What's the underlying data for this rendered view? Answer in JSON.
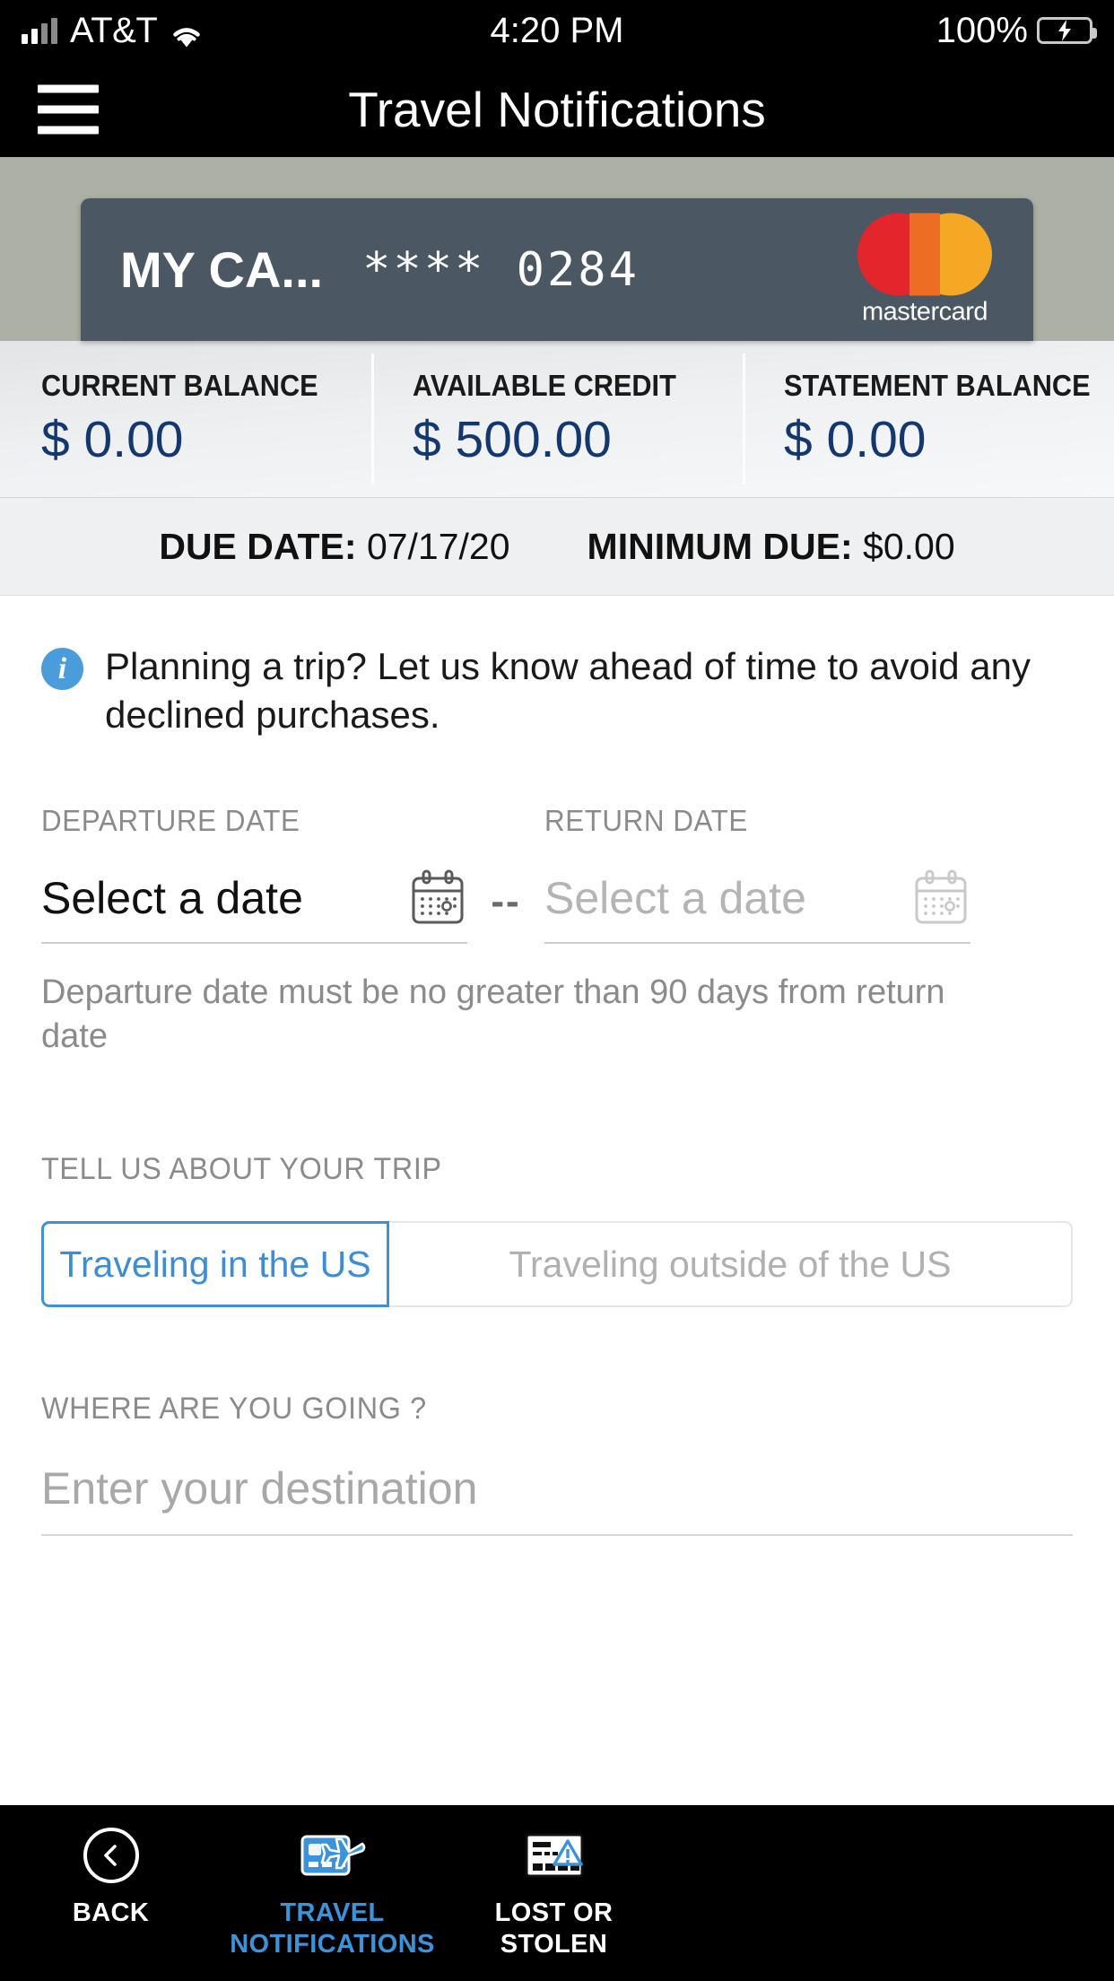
{
  "status_bar": {
    "carrier": "AT&T",
    "time": "4:20 PM",
    "battery_percent": "100%",
    "signal_icon": "signal-bars-icon",
    "wifi_icon": "wifi-icon",
    "battery_icon": "battery-charging-icon"
  },
  "nav": {
    "menu_icon": "hamburger-menu-icon",
    "title": "Travel Notifications"
  },
  "card": {
    "name": "MY CA...",
    "masked_number": "**** 0284",
    "network": "mastercard",
    "network_logo_icon": "mastercard-logo-icon",
    "colors": {
      "card_bg": "#4c5764",
      "strip_bg": "#adb0a4"
    }
  },
  "balances": [
    {
      "label": "CURRENT BALANCE",
      "value": "$ 0.00"
    },
    {
      "label": "AVAILABLE CREDIT",
      "value": "$ 500.00"
    },
    {
      "label": "STATEMENT BALANCE",
      "value": "$ 0.00"
    }
  ],
  "due": {
    "due_date_label": "DUE DATE:",
    "due_date_value": "07/17/20",
    "minimum_due_label": "MINIMUM DUE:",
    "minimum_due_value": "$0.00"
  },
  "info_banner": {
    "icon": "info-circle-icon",
    "text": "Planning a trip? Let us know ahead of time to avoid any declined purchases.",
    "icon_color": "#4a9cdb"
  },
  "dates": {
    "departure_label": "DEPARTURE DATE",
    "departure_value": "Select a date",
    "separator": "--",
    "return_label": "RETURN DATE",
    "return_value": "Select a date",
    "calendar_icon": "calendar-icon",
    "hint": "Departure date must be no greater than 90 days from return date"
  },
  "trip": {
    "section_label": "TELL US ABOUT YOUR TRIP",
    "option_in_us": "Traveling in the US",
    "option_outside_us": "Traveling outside of the US",
    "selected": "Traveling in the US",
    "accent_color": "#4190d6"
  },
  "destination": {
    "section_label": "WHERE ARE YOU GOING ?",
    "value": "",
    "placeholder": "Enter your destination"
  },
  "tabbar": {
    "items": [
      {
        "label": "BACK",
        "icon": "back-chevron-circle-icon",
        "active": false
      },
      {
        "label": "TRAVEL NOTIFICATIONS",
        "line1": "TRAVEL",
        "line2": "NOTIFICATIONS",
        "icon": "card-airplane-icon",
        "active": true
      },
      {
        "label": "LOST OR STOLEN",
        "line1": "LOST OR",
        "line2": "STOLEN",
        "icon": "card-warning-icon",
        "active": false
      }
    ],
    "active_color": "#3d93da"
  }
}
